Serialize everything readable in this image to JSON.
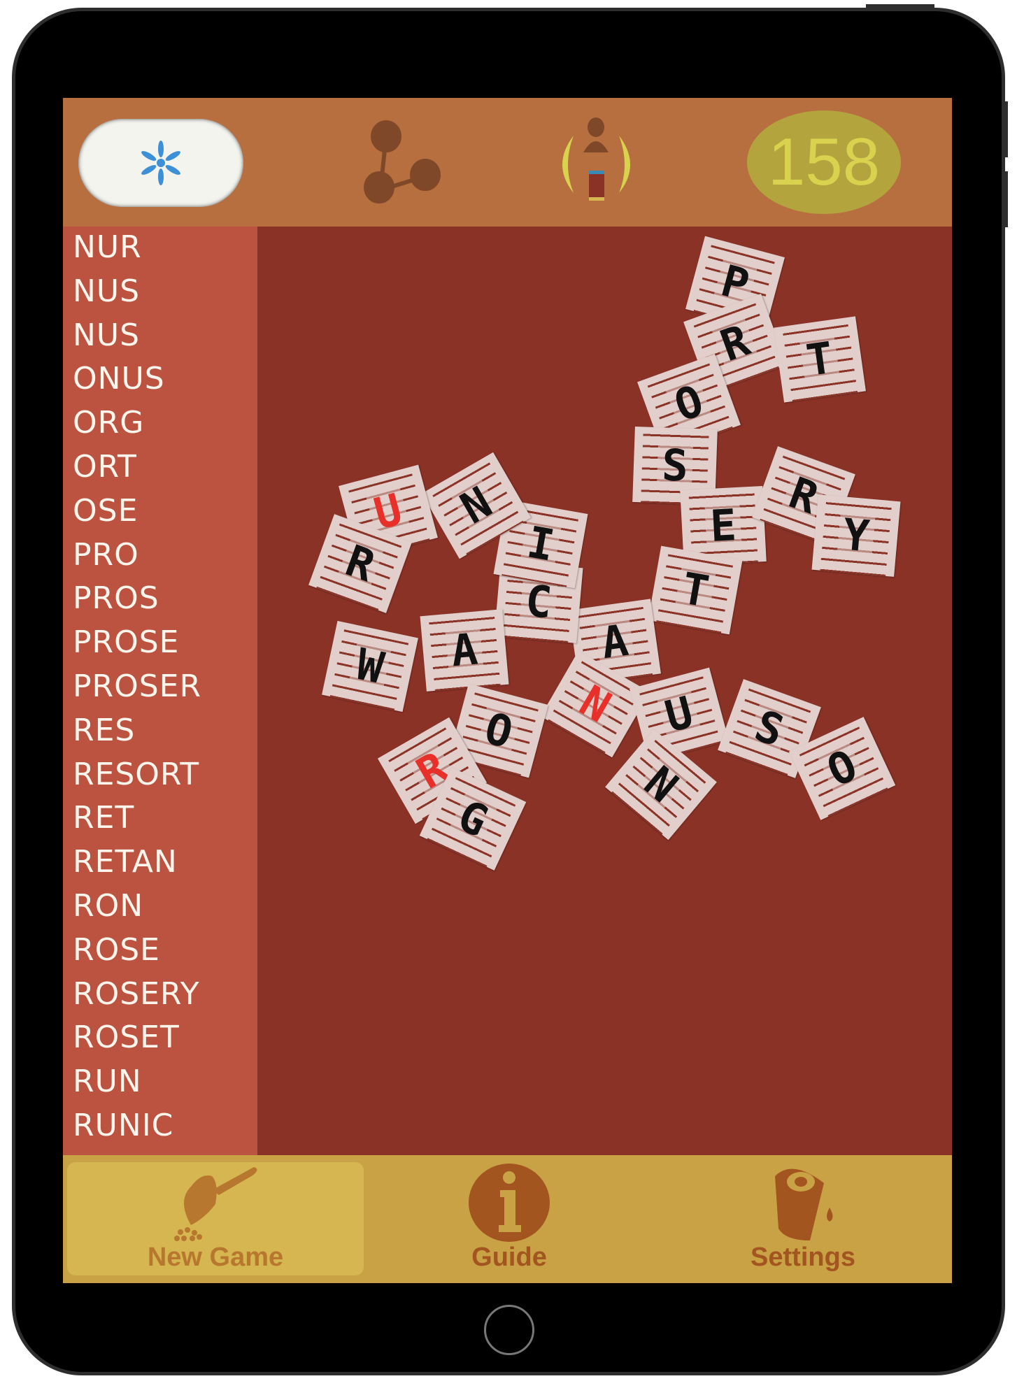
{
  "header": {
    "hint_icon": "asterisk-icon",
    "share_icon": "share-icon",
    "profile_icon": "player-badge-icon",
    "score": "158"
  },
  "colors": {
    "topbar": "#b86f3f",
    "wordlist": "#bc5240",
    "board": "#8b3227",
    "bottombar": "#caa246",
    "score_bg": "#b3a43e",
    "score_text": "#d9d24e",
    "highlight_letter": "#e8302a",
    "tab_text": "#b8772e"
  },
  "words": [
    "NUR",
    "NUS",
    "NUS",
    "ONUS",
    "ORG",
    "ORT",
    "OSE",
    "PRO",
    "PROS",
    "PROSE",
    "PROSER",
    "RES",
    "RESORT",
    "RET",
    "RETAN",
    "RON",
    "ROSE",
    "ROSERY",
    "ROSET",
    "RUN",
    "RUNIC"
  ],
  "tiles": [
    {
      "letter": "P",
      "highlight": false
    },
    {
      "letter": "R",
      "highlight": false
    },
    {
      "letter": "T",
      "highlight": false
    },
    {
      "letter": "O",
      "highlight": false
    },
    {
      "letter": "S",
      "highlight": false
    },
    {
      "letter": "E",
      "highlight": false
    },
    {
      "letter": "R",
      "highlight": false
    },
    {
      "letter": "Y",
      "highlight": false
    },
    {
      "letter": "T",
      "highlight": false
    },
    {
      "letter": "A",
      "highlight": false
    },
    {
      "letter": "C",
      "highlight": false
    },
    {
      "letter": "I",
      "highlight": false
    },
    {
      "letter": "N",
      "highlight": false
    },
    {
      "letter": "U",
      "highlight": true
    },
    {
      "letter": "R",
      "highlight": false
    },
    {
      "letter": "W",
      "highlight": false
    },
    {
      "letter": "A",
      "highlight": false
    },
    {
      "letter": "N",
      "highlight": true
    },
    {
      "letter": "O",
      "highlight": false
    },
    {
      "letter": "R",
      "highlight": true
    },
    {
      "letter": "G",
      "highlight": false
    },
    {
      "letter": "U",
      "highlight": false
    },
    {
      "letter": "S",
      "highlight": false
    },
    {
      "letter": "O",
      "highlight": false
    },
    {
      "letter": "N",
      "highlight": false
    }
  ],
  "tabs": [
    {
      "label": "New Game",
      "icon": "scoop-icon",
      "active": true
    },
    {
      "label": "Guide",
      "icon": "info-icon",
      "active": false
    },
    {
      "label": "Settings",
      "icon": "paint-bucket-icon",
      "active": false
    }
  ]
}
